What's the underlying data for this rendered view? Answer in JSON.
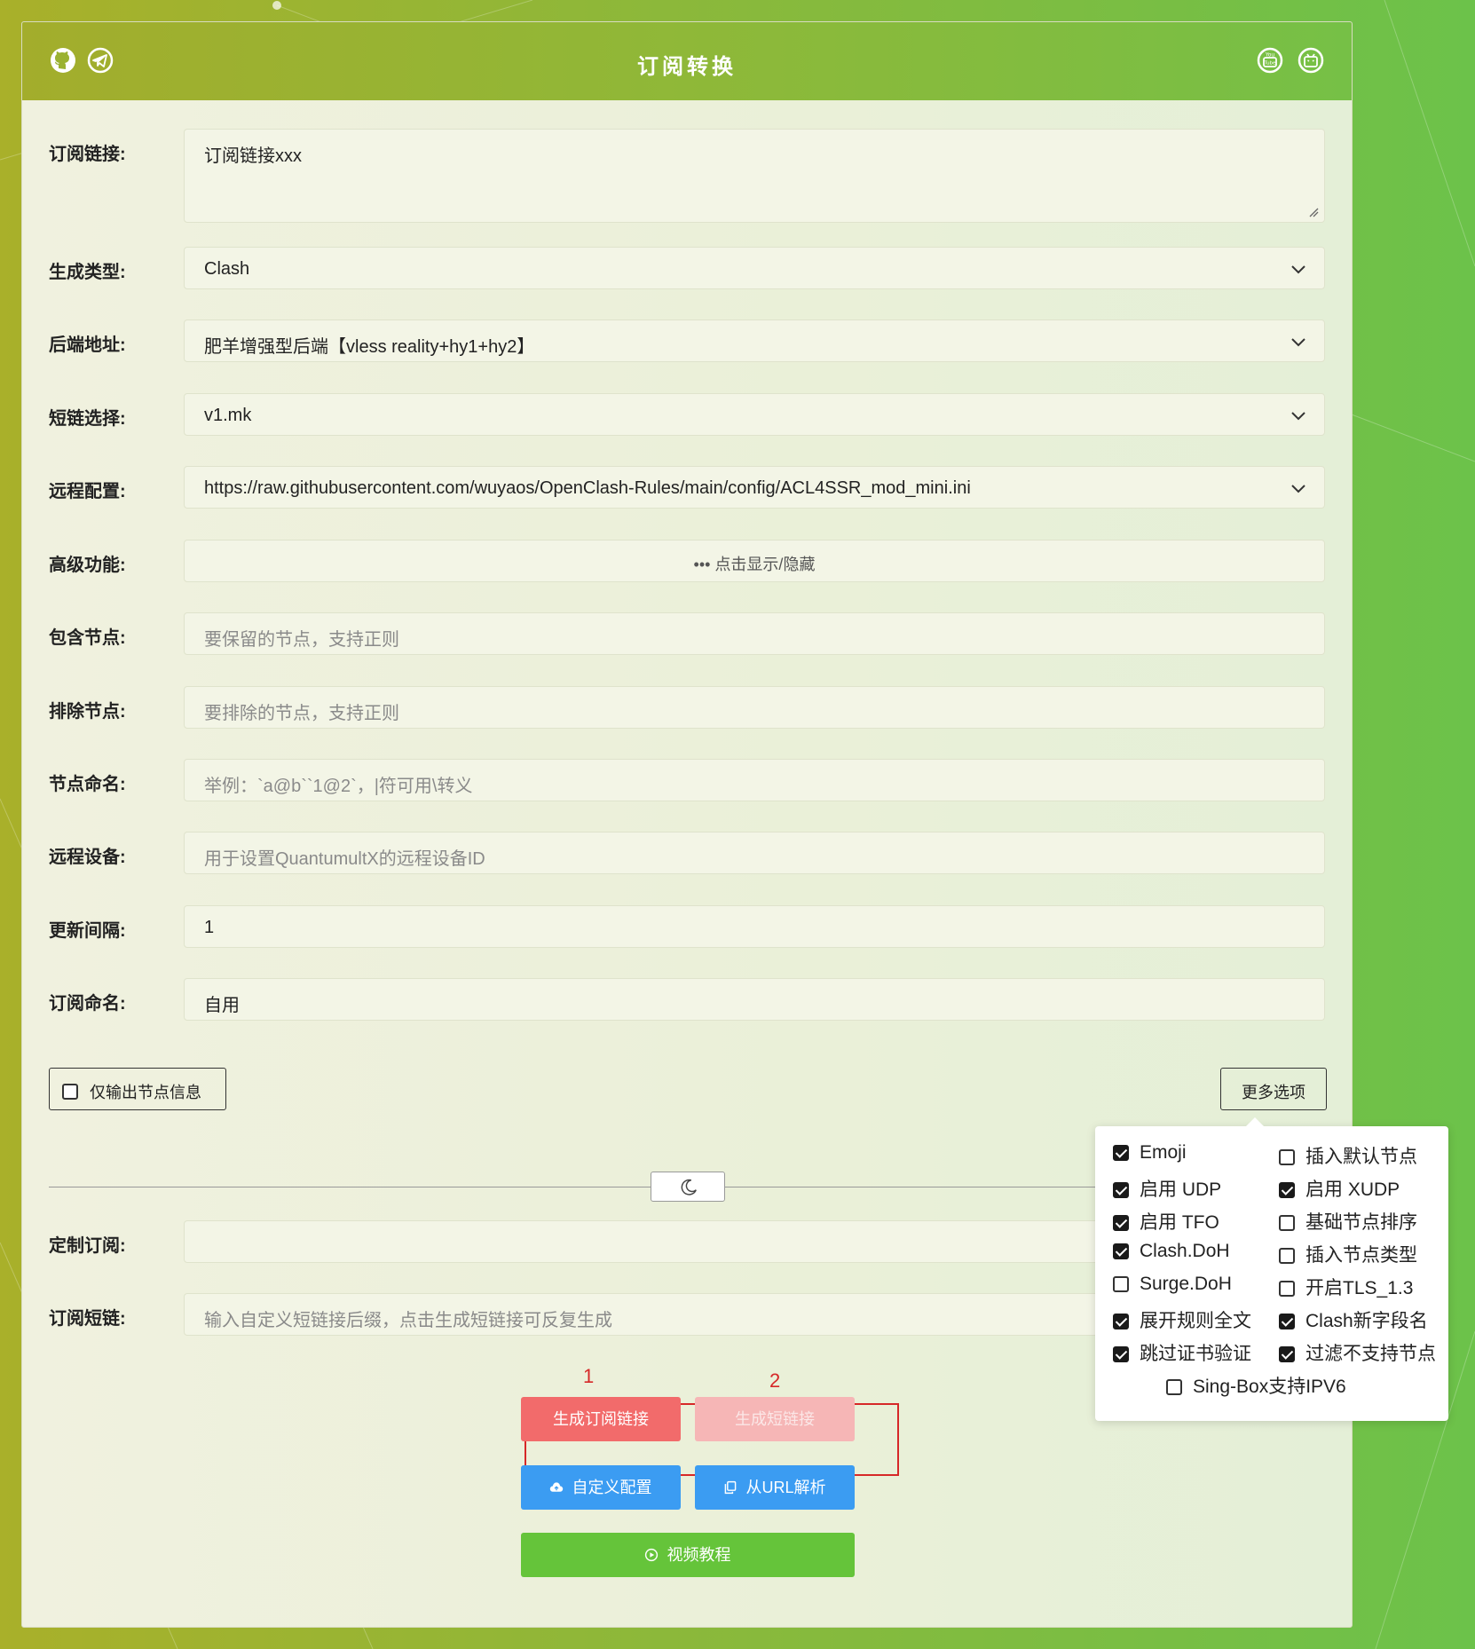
{
  "header": {
    "title": "订阅转换"
  },
  "form": {
    "sub_url_label": "订阅链接:",
    "sub_url_value": "订阅链接xxx",
    "target_label": "生成类型:",
    "target_value": "Clash",
    "backend_label": "后端地址:",
    "backend_value": "肥羊增强型后端【vless reality+hy1+hy2】",
    "shortlink_select_label": "短链选择:",
    "shortlink_select_value": "v1.mk",
    "remote_config_label": "远程配置:",
    "remote_config_value": "https://raw.githubusercontent.com/wuyaos/OpenClash-Rules/main/config/ACL4SSR_mod_mini.ini",
    "advanced_label": "高级功能:",
    "advanced_value": "••• 点击显示/隐藏",
    "include_label": "包含节点:",
    "include_placeholder": "要保留的节点，支持正则",
    "exclude_label": "排除节点:",
    "exclude_placeholder": "要排除的节点，支持正则",
    "rename_label": "节点命名:",
    "rename_placeholder": "举例：`a@b``1@2`，|符可用\\转义",
    "device_label": "远程设备:",
    "device_placeholder": "用于设置QuantumultX的远程设备ID",
    "interval_label": "更新间隔:",
    "interval_value": "1",
    "filename_label": "订阅命名:",
    "filename_value": "自用",
    "nodelist_label": "仅输出节点信息",
    "more_options_label": "更多选项",
    "custom_sub_label": "定制订阅:",
    "custom_sub_value": "",
    "short_sub_label": "订阅短链:",
    "short_sub_placeholder": "输入自定义短链接后缀，点击生成短链接可反复生成"
  },
  "options": [
    {
      "label": "Emoji",
      "checked": true
    },
    {
      "label": "插入默认节点",
      "checked": false
    },
    {
      "label": "启用 UDP",
      "checked": true
    },
    {
      "label": "启用 XUDP",
      "checked": true
    },
    {
      "label": "启用 TFO",
      "checked": true
    },
    {
      "label": "基础节点排序",
      "checked": false
    },
    {
      "label": "Clash.DoH",
      "checked": true
    },
    {
      "label": "插入节点类型",
      "checked": false
    },
    {
      "label": "Surge.DoH",
      "checked": false
    },
    {
      "label": "开启TLS_1.3",
      "checked": false
    },
    {
      "label": "展开规则全文",
      "checked": true
    },
    {
      "label": "Clash新字段名",
      "checked": true
    },
    {
      "label": "跳过证书验证",
      "checked": true
    },
    {
      "label": "过滤不支持节点",
      "checked": true
    },
    {
      "label": "Sing-Box支持IPV6",
      "checked": false
    }
  ],
  "buttons": {
    "gen_sub": "生成订阅链接",
    "gen_short": "生成短链接",
    "custom_config": "自定义配置",
    "parse_url": "从URL解析",
    "video": "视频教程"
  },
  "annotations": {
    "one": "1",
    "two": "2"
  },
  "colors": {
    "red": "#f26b6b",
    "pink": "#f6b6b6",
    "blue": "#3b9cf2",
    "green": "#65c43a",
    "annotation": "#d62828"
  }
}
